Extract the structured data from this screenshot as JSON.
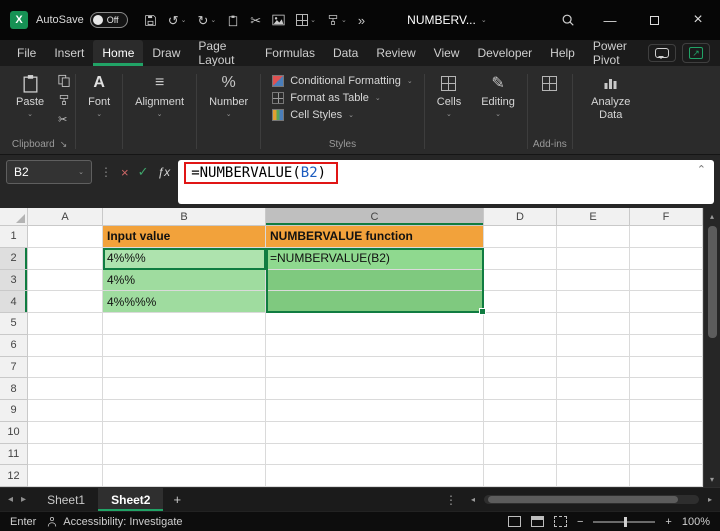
{
  "icons": {
    "chevron_down": "⌄",
    "chevron_up": "⌃",
    "more": "»",
    "undo": "↺",
    "redo": "↻",
    "cut": "✂",
    "check": "✓",
    "cross": "×",
    "ellipsis_v": "⋮",
    "minimize": "—",
    "plus": "+",
    "minus": "−",
    "up_small": "▴",
    "down_small": "▾",
    "left_small": "◂",
    "right_small": "▸",
    "fx": "ƒx",
    "font": "A",
    "align": "≡",
    "percent": "%",
    "edit": "✎",
    "launcher": "↘",
    "share_arrow": "↗"
  },
  "titlebar": {
    "autosave_label": "AutoSave",
    "autosave_state": "Off",
    "title": "NUMBERV..."
  },
  "ribbon_tabs": [
    "File",
    "Insert",
    "Home",
    "Draw",
    "Page Layout",
    "Formulas",
    "Data",
    "Review",
    "View",
    "Developer",
    "Help",
    "Power Pivot"
  ],
  "ribbon": {
    "paste": "Paste",
    "clipboard": "Clipboard",
    "font": "Font",
    "alignment": "Alignment",
    "number": "Number",
    "conditional_formatting": "Conditional Formatting",
    "format_as_table": "Format as Table",
    "cell_styles": "Cell Styles",
    "styles": "Styles",
    "cells": "Cells",
    "editing": "Editing",
    "addins": "Add-ins",
    "analyze_data": "Analyze Data"
  },
  "formula_bar": {
    "name_box": "B2",
    "prefix": "=NUMBERVALUE(",
    "ref": "B2",
    "suffix": ")"
  },
  "grid": {
    "columns": [
      "A",
      "B",
      "C",
      "D",
      "E",
      "F"
    ],
    "row_numbers": [
      "1",
      "2",
      "3",
      "4",
      "5",
      "6",
      "7",
      "8",
      "9",
      "10",
      "11",
      "12"
    ],
    "cells": {
      "b1": "Input value",
      "c1": "NUMBERVALUE function",
      "b2": "4%%%",
      "c2": "=NUMBERVALUE(B2)",
      "b3": "4%%",
      "b4": "4%%%%"
    }
  },
  "sheet_bar": {
    "tabs": [
      "Sheet1",
      "Sheet2"
    ]
  },
  "status_bar": {
    "mode": "Enter",
    "accessibility": "Accessibility: Investigate",
    "zoom": "100%"
  },
  "colors": {
    "accent_green": "#21A366",
    "selection_green": "#107C41",
    "orange_fill": "#F2A23B",
    "light_green": "#9FDC9F",
    "green": "#7FC97F",
    "annotation_red": "#E01515"
  }
}
